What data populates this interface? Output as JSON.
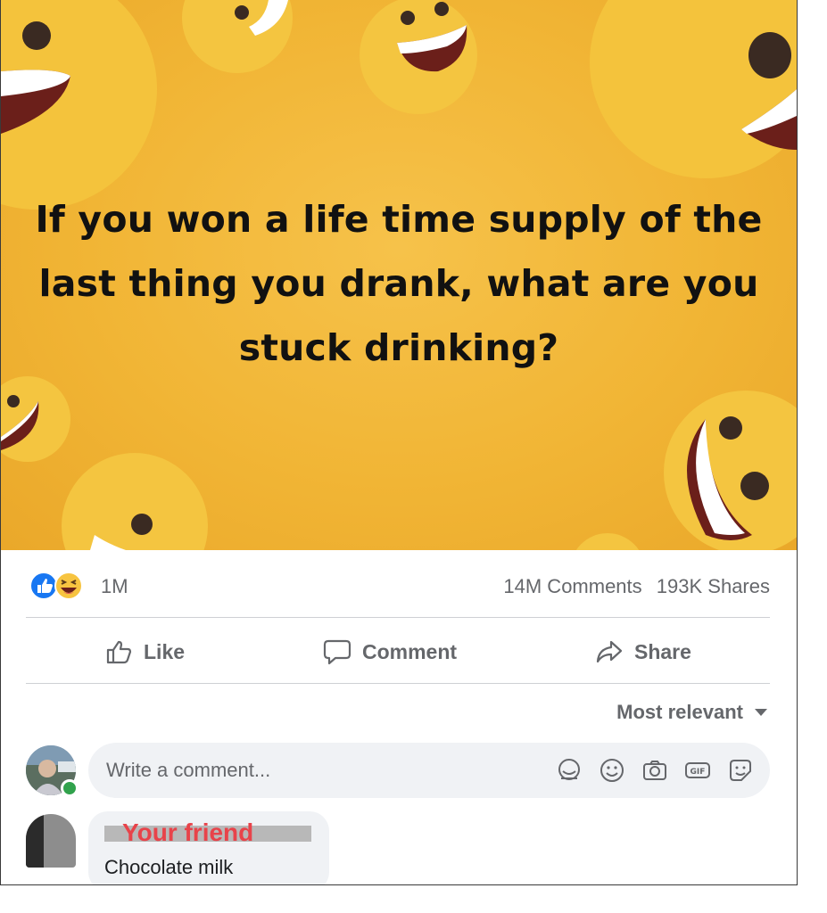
{
  "post": {
    "image_text": "If you won a life time supply of the last thing you drank, what are you stuck drinking?",
    "image_bg_color": "#f1b535"
  },
  "stats": {
    "reactions": [
      "like-icon",
      "haha-icon"
    ],
    "reaction_count": "1M",
    "comments": "14M Comments",
    "shares": "193K Shares"
  },
  "actions": {
    "like": "Like",
    "comment": "Comment",
    "share": "Share"
  },
  "comments": {
    "sort_label": "Most relevant",
    "input_placeholder": "Write a comment...",
    "input_icons": [
      "avatar-sticker-icon",
      "emoji-icon",
      "camera-icon",
      "gif-icon",
      "sticker-icon"
    ],
    "items": [
      {
        "author": "Your friend",
        "text": "Chocolate milk"
      }
    ]
  },
  "colors": {
    "accent": "#1877f2",
    "secondary_text": "#65676b",
    "friend_label": "#e8434a"
  }
}
